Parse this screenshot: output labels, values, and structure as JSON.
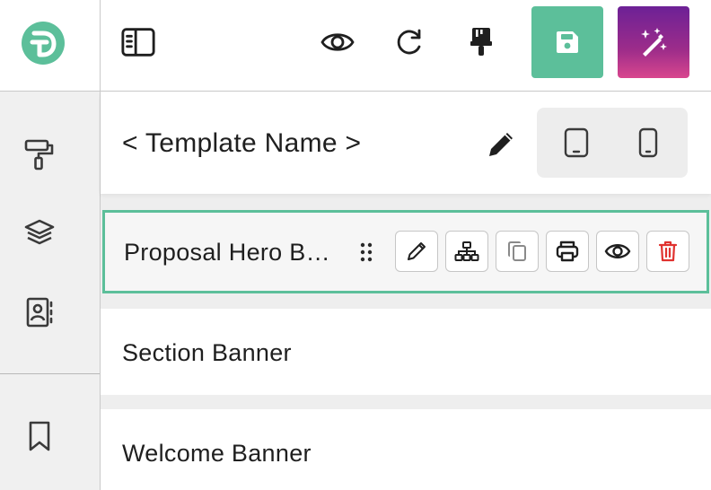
{
  "rail": {
    "logo": {
      "icon": "d-logo-icon",
      "letter": "D",
      "color": "#5cbf9a"
    },
    "items": [
      {
        "name": "paint-roller",
        "icon": "paint-roller-icon"
      },
      {
        "name": "layers",
        "icon": "layers-icon"
      },
      {
        "name": "contacts",
        "icon": "contact-book-icon"
      },
      {
        "name": "bookmark",
        "icon": "bookmark-icon"
      }
    ]
  },
  "toolbar": {
    "buttons": [
      {
        "name": "toggle-sidebar",
        "icon": "sidebar-panel-icon"
      },
      {
        "name": "preview",
        "icon": "eye-icon"
      },
      {
        "name": "redo",
        "icon": "redo-icon"
      },
      {
        "name": "brush",
        "icon": "paint-brush-icon"
      },
      {
        "name": "save",
        "icon": "floppy-disk-icon",
        "color": "#5cbf9a"
      },
      {
        "name": "ai-magic",
        "icon": "magic-wand-sparkles-icon",
        "gradient": [
          "#6c2196",
          "#d9468e"
        ]
      }
    ]
  },
  "template": {
    "name": "< Template Name >",
    "edit_icon": "pencil-icon",
    "devices": [
      {
        "name": "tablet",
        "icon": "tablet-icon"
      },
      {
        "name": "mobile",
        "icon": "mobile-icon"
      }
    ]
  },
  "blocks": [
    {
      "label": "Proposal Hero Banner",
      "selected": true,
      "actions": [
        {
          "name": "edit",
          "icon": "pencil-icon"
        },
        {
          "name": "structure",
          "icon": "sitemap-icon"
        },
        {
          "name": "duplicate",
          "icon": "copy-icon"
        },
        {
          "name": "print",
          "icon": "printer-icon"
        },
        {
          "name": "visibility",
          "icon": "eye-icon"
        },
        {
          "name": "delete",
          "icon": "trash-icon",
          "color": "#e0322f"
        }
      ]
    },
    {
      "label": "Section Banner",
      "selected": false
    },
    {
      "label": "Welcome Banner",
      "selected": false
    }
  ],
  "colors": {
    "accent": "#5cbf9a",
    "danger": "#e0322f",
    "rail_bg": "#f0f0f0",
    "panel_bg": "#eeeeee"
  }
}
